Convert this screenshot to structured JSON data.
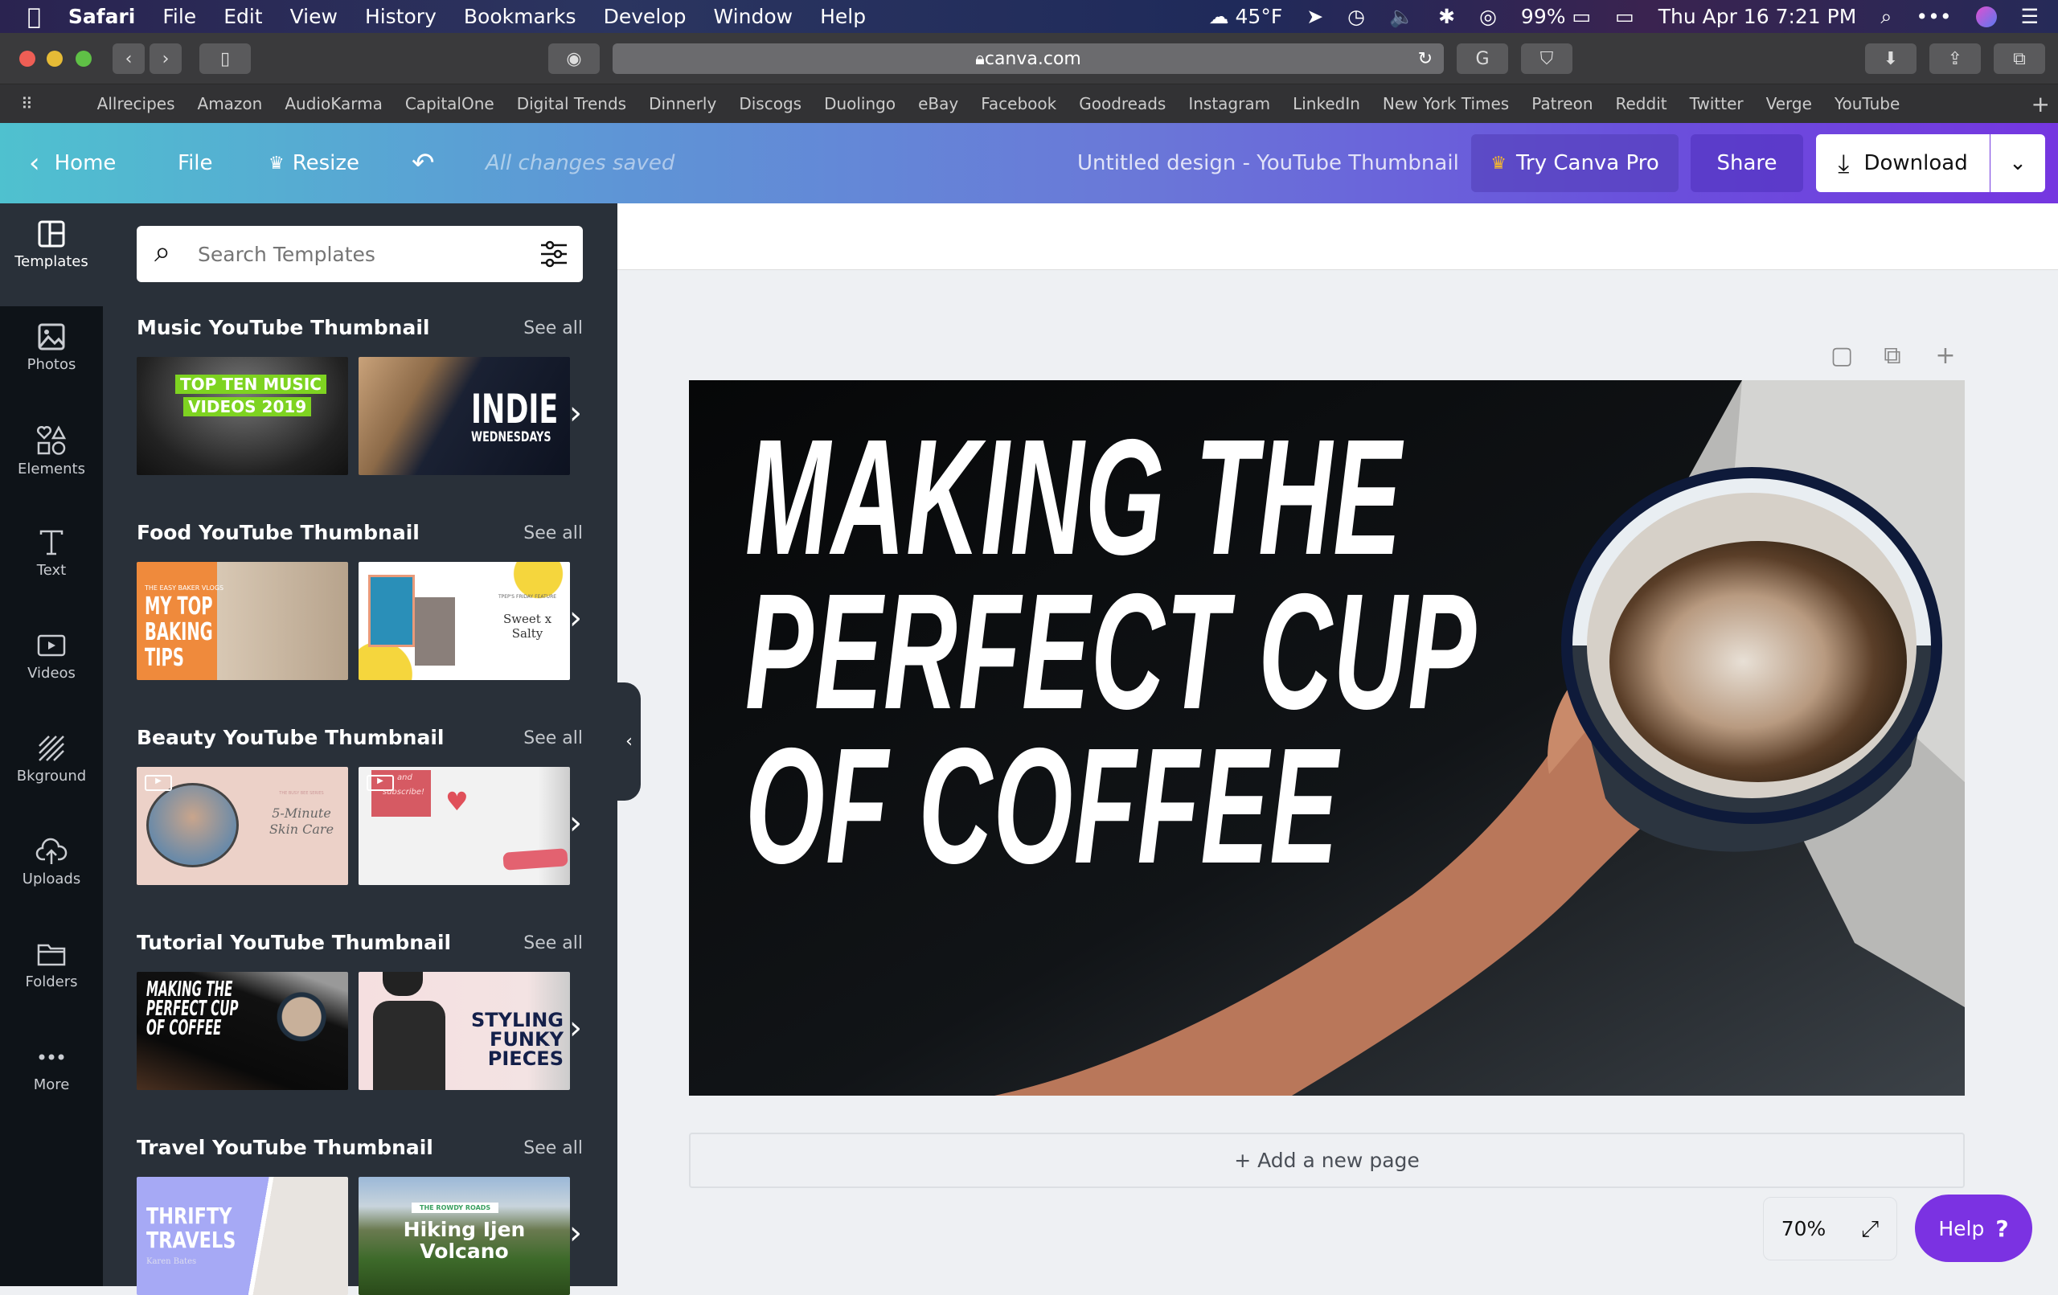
{
  "menubar": {
    "app": "Safari",
    "items": [
      "File",
      "Edit",
      "View",
      "History",
      "Bookmarks",
      "Develop",
      "Window",
      "Help"
    ],
    "weather": "45°F",
    "battery": "99%",
    "datetime": "Thu Apr 16  7:21 PM"
  },
  "browser": {
    "url": "canva.com",
    "bookmarks": [
      "Allrecipes",
      "Amazon",
      "AudioKarma",
      "CapitalOne",
      "Digital Trends",
      "Dinnerly",
      "Discogs",
      "Duolingo",
      "eBay",
      "Facebook",
      "Goodreads",
      "Instagram",
      "LinkedIn",
      "New York Times",
      "Patreon",
      "Reddit",
      "Twitter",
      "Verge",
      "YouTube"
    ]
  },
  "header": {
    "home": "Home",
    "file": "File",
    "resize": "Resize",
    "status": "All changes saved",
    "design_title": "Untitled design - YouTube Thumbnail",
    "try_pro": "Try Canva Pro",
    "share": "Share",
    "download": "Download",
    "gradient": [
      "#4fc1cf",
      "#7536e0"
    ]
  },
  "rail": [
    {
      "label": "Templates",
      "icon": "templates-icon"
    },
    {
      "label": "Photos",
      "icon": "photos-icon"
    },
    {
      "label": "Elements",
      "icon": "elements-icon"
    },
    {
      "label": "Text",
      "icon": "text-icon"
    },
    {
      "label": "Videos",
      "icon": "videos-icon"
    },
    {
      "label": "Bkground",
      "icon": "background-icon"
    },
    {
      "label": "Uploads",
      "icon": "uploads-icon"
    },
    {
      "label": "Folders",
      "icon": "folders-icon"
    },
    {
      "label": "More",
      "icon": "more-icon"
    }
  ],
  "panel": {
    "search_placeholder": "Search Templates",
    "see_all": "See all",
    "sections": [
      {
        "title": "Music YouTube Thumbnail",
        "thumbs": [
          [
            "TOP TEN MUSIC",
            "VIDEOS 2019"
          ],
          [
            "INDIE",
            "WEDNESDAYS"
          ]
        ]
      },
      {
        "title": "Food YouTube Thumbnail",
        "thumbs": [
          [
            "THE EASY BAKER VLOGS",
            "MY TOP BAKING TIPS"
          ],
          [
            "TPEP'S FRIDAY FEATURE",
            "Sweet x Salty"
          ]
        ]
      },
      {
        "title": "Beauty YouTube Thumbnail",
        "thumbs": [
          [
            "THE BUSY BEE SERIES",
            "5-Minute Skin Care"
          ],
          [
            "and",
            "subscribe!"
          ]
        ]
      },
      {
        "title": "Tutorial YouTube Thumbnail",
        "thumbs": [
          [
            "",
            "MAKING THE PERFECT CUP OF COFFEE"
          ],
          [
            "",
            "STYLING FUNKY PIECES"
          ]
        ]
      },
      {
        "title": "Travel YouTube Thumbnail",
        "thumbs": [
          [
            "Karen Bates",
            "THRIFTY TRAVELS"
          ],
          [
            "THE ROWDY ROADS",
            "Hiking Ijen Volcano"
          ]
        ]
      }
    ]
  },
  "canvas": {
    "lines": [
      "MAKING THE",
      "PERFECT CUP",
      "OF COFFEE"
    ],
    "add_page": "+ Add a new page",
    "zoom": "70%",
    "help": "Help",
    "help_icon": "?"
  }
}
